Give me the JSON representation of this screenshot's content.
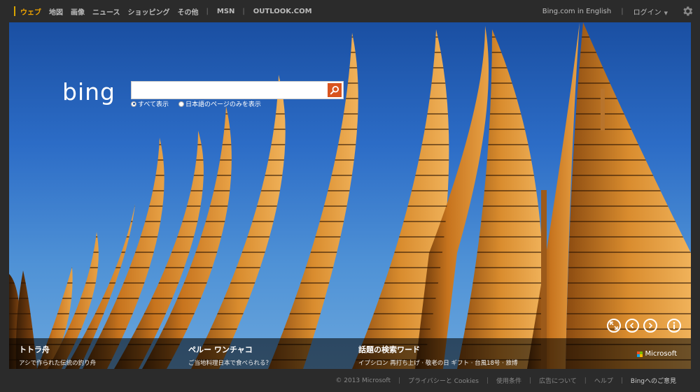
{
  "nav": {
    "items": [
      {
        "label": "ウェブ",
        "active": true
      },
      {
        "label": "地図"
      },
      {
        "label": "画像"
      },
      {
        "label": "ニュース"
      },
      {
        "label": "ショッピング"
      },
      {
        "label": "その他"
      }
    ],
    "separator": "|",
    "msn": "MSN",
    "outlook": "OUTLOOK.COM",
    "english_link": "Bing.com in English",
    "login": "ログイン",
    "settings_icon": "gear-icon",
    "accent_color": "#f0a400"
  },
  "search": {
    "logo_text": "bing",
    "value": "",
    "placeholder": "",
    "button_icon": "search-icon",
    "button_color": "#d9541e",
    "scope_all": "すべて表示",
    "scope_japanese": "日本語のページのみを表示"
  },
  "hero": {
    "controls": {
      "fullscreen_icon": "expand-icon",
      "prev_icon": "chevron-left-icon",
      "next_icon": "chevron-right-icon",
      "info_icon": "info-icon"
    },
    "captions": [
      {
        "title": "トトラ舟",
        "subtitle": "アシで作られた伝統の釣り舟"
      },
      {
        "title": "ペルー ワンチャコ",
        "subtitle": "ご当地料理日本で食べられる？"
      },
      {
        "title": "話題の検索ワード",
        "subtitle": "イプシロン 再打ち上げ · 敬老の日 ギフト · 台風18号 · 旅博"
      }
    ],
    "brand": "Microsoft"
  },
  "footer": {
    "copyright": "© 2013 Microsoft",
    "links": [
      "プライバシーと Cookies",
      "使用条件",
      "広告について",
      "ヘルプ"
    ],
    "feedback": "Bingへのご意見"
  }
}
